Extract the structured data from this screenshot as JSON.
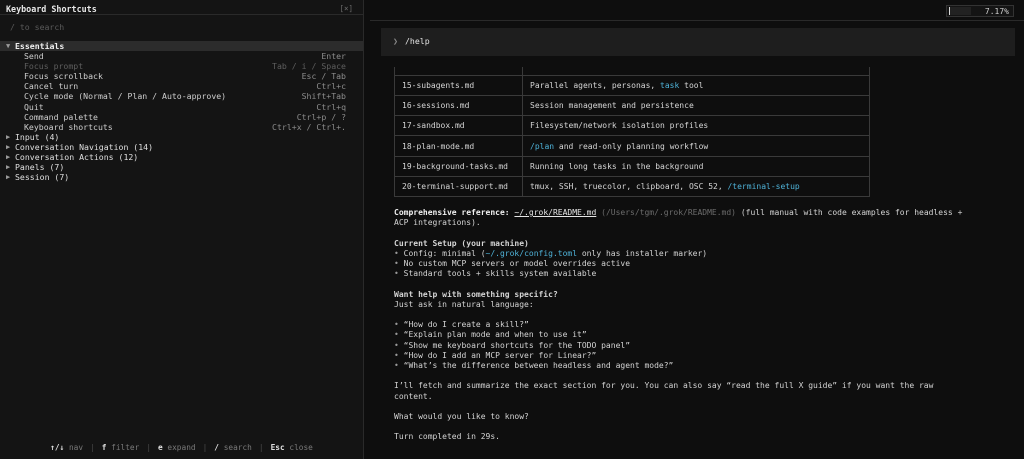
{
  "left_panel": {
    "title": "Keyboard Shortcuts",
    "close": "[×]",
    "search_placeholder": "/ to search",
    "groups": [
      {
        "label": "Essentials",
        "expanded": true,
        "selected": true,
        "items": [
          {
            "label": "Send",
            "keys": "Enter",
            "dim": false
          },
          {
            "label": "Focus prompt",
            "keys": "Tab / i / Space",
            "dim": true
          },
          {
            "label": "Focus scrollback",
            "keys": "Esc / Tab",
            "dim": false
          },
          {
            "label": "Cancel turn",
            "keys": "Ctrl+c",
            "dim": false
          },
          {
            "label": "Cycle mode (Normal / Plan / Auto-approve)",
            "keys": "Shift+Tab",
            "dim": false
          },
          {
            "label": "Quit",
            "keys": "Ctrl+q",
            "dim": false
          },
          {
            "label": "Command palette",
            "keys": "Ctrl+p / ?",
            "dim": false
          },
          {
            "label": "Keyboard shortcuts",
            "keys": "Ctrl+x / Ctrl+.",
            "dim": false
          }
        ]
      },
      {
        "label": "Input (4)",
        "expanded": false
      },
      {
        "label": "Conversation Navigation (14)",
        "expanded": false
      },
      {
        "label": "Conversation Actions (12)",
        "expanded": false
      },
      {
        "label": "Panels (7)",
        "expanded": false
      },
      {
        "label": "Session (7)",
        "expanded": false
      }
    ],
    "footer": [
      {
        "key": "↑/↓",
        "action": "nav"
      },
      {
        "key": "f",
        "action": "filter"
      },
      {
        "key": "e",
        "action": "expand"
      },
      {
        "key": "/",
        "action": "search"
      },
      {
        "key": "Esc",
        "action": "close"
      }
    ]
  },
  "usage": {
    "fraction": 0.0717,
    "label": "7.17%"
  },
  "prompt": {
    "chevron": "❯",
    "text": "/help"
  },
  "table": {
    "rows": [
      {
        "file": "15-subagents.md",
        "pre": "Parallel agents, personas, ",
        "hl": "task",
        "post": " tool"
      },
      {
        "file": "16-sessions.md",
        "pre": "Session management and persistence",
        "hl": "",
        "post": ""
      },
      {
        "file": "17-sandbox.md",
        "pre": "Filesystem/network isolation profiles",
        "hl": "",
        "post": ""
      },
      {
        "file": "18-plan-mode.md",
        "pre": "",
        "hl": "/plan",
        "post": " and read-only planning workflow"
      },
      {
        "file": "19-background-tasks.md",
        "pre": "Running long tasks in the background",
        "hl": "",
        "post": ""
      },
      {
        "file": "20-terminal-support.md",
        "pre": "tmux, SSH, truecolor, clipboard, OSC 52, ",
        "hl": "/terminal-setup",
        "post": ""
      }
    ]
  },
  "body": {
    "ref_label": "Comprehensive reference:",
    "ref_link": "~/.grok/README.md",
    "ref_path": "(/Users/tgm/.grok/README.md)",
    "ref_desc_1": "(full manual with code examples for headless +",
    "ref_desc_2": "ACP integrations).",
    "setup_heading": "Current Setup (your machine)",
    "setup_1_pre": "Config: minimal (",
    "setup_1_link": "~/.grok/config.toml",
    "setup_1_post": " only has installer marker)",
    "setup_2": "No custom MCP servers or model overrides active",
    "setup_3": "Standard tools + skills system available",
    "help_heading": "Want help with something specific?",
    "help_sub": "Just ask in natural language:",
    "questions": [
      "“How do I create a skill?”",
      "“Explain plan mode and when to use it”",
      "“Show me keyboard shortcuts for the TODO panel”",
      "“How do I add an MCP server for Linear?”",
      "“What’s the difference between headless and agent mode?”"
    ],
    "fetch_1": "I’ll fetch and summarize the exact section for you. You can also say “read the full X guide” if you want the raw",
    "fetch_2": "content.",
    "closing": "What would you like to know?",
    "status": "Turn completed in 29s."
  }
}
